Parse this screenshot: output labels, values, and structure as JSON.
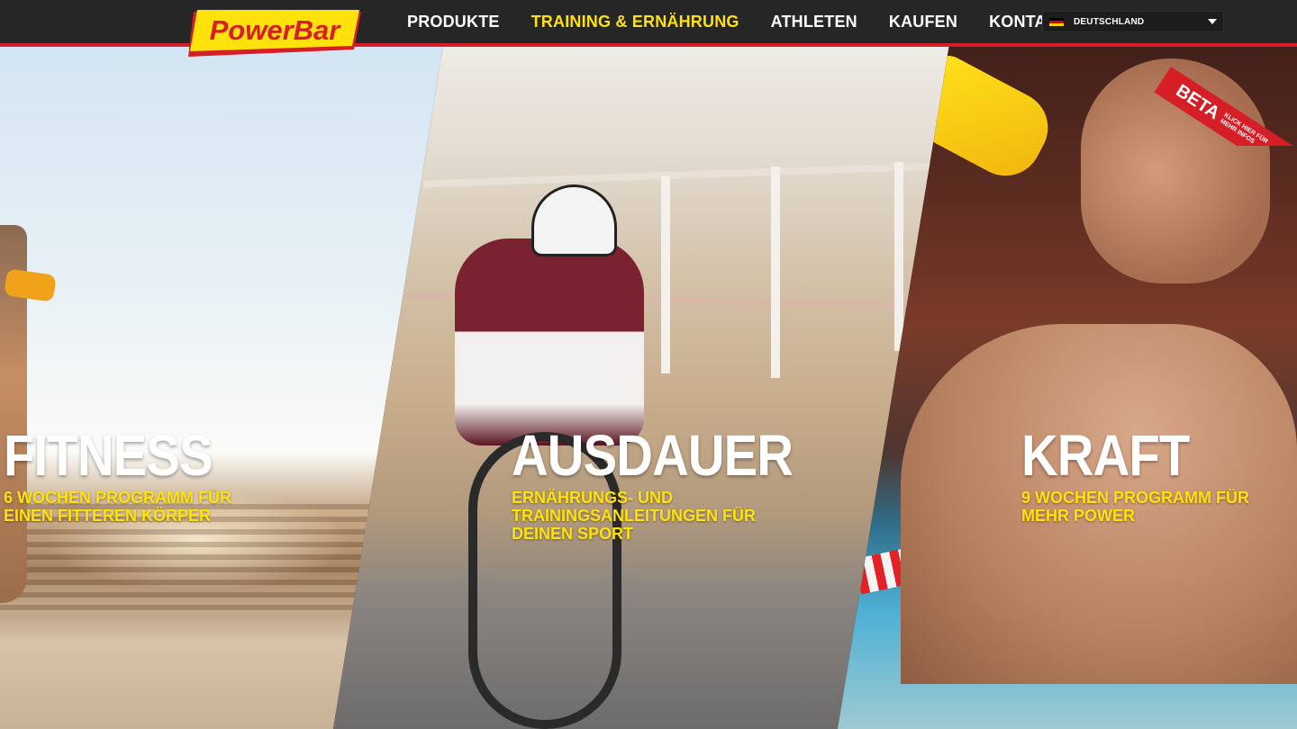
{
  "brand": {
    "logo_text": "PowerBar",
    "accent": "#ffe20b",
    "red": "#d51e26"
  },
  "nav": [
    {
      "label": "PRODUKTE",
      "active": false
    },
    {
      "label": "TRAINING & ERNÄHRUNG",
      "active": true
    },
    {
      "label": "ATHLETEN",
      "active": false
    },
    {
      "label": "KAUFEN",
      "active": false
    },
    {
      "label": "KONTAKT",
      "active": false
    }
  ],
  "language": {
    "selected": "DEUTSCHLAND",
    "icon": "german-flag-icon"
  },
  "panels": [
    {
      "title": "FITNESS",
      "subtitle": "6 WOCHEN PROGRAMM FÜR EINEN FITTEREN KÖRPER"
    },
    {
      "title": "AUSDAUER",
      "subtitle": "ERNÄHRUNGS- UND TRAININGSANLEITUNGEN FÜR DEINEN SPORT"
    },
    {
      "title": "KRAFT",
      "subtitle": "9 WOCHEN PROGRAMM FÜR MEHR POWER"
    }
  ],
  "beta": {
    "label": "BETA",
    "sub": "KLICK HIER FÜR MEHR INFOS"
  }
}
